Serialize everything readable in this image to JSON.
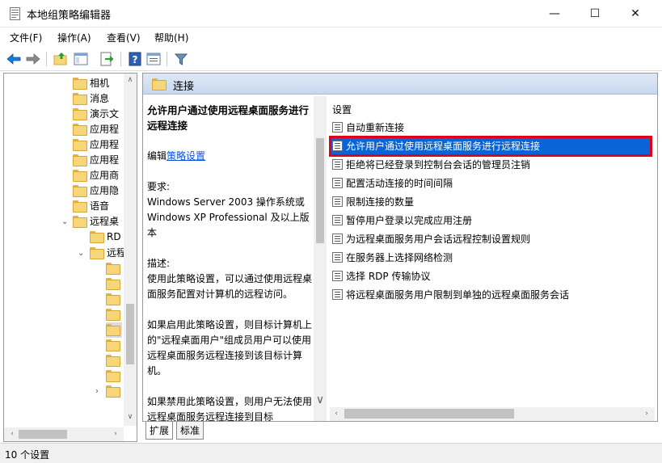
{
  "window": {
    "title": "本地组策略编辑器",
    "minimize": "—",
    "maximize": "☐",
    "close": "✕"
  },
  "menu": [
    {
      "label": "文件(F)"
    },
    {
      "label": "操作(A)"
    },
    {
      "label": "查看(V)"
    },
    {
      "label": "帮助(H)"
    }
  ],
  "toolbar": [
    "back-icon",
    "forward-icon",
    "up-folder-icon",
    "show-hide-tree-icon",
    "export-list-icon",
    "help-icon",
    "properties-icon",
    "filter-icon"
  ],
  "tree": {
    "items": [
      {
        "label": "相机"
      },
      {
        "label": "消息"
      },
      {
        "label": "演示文"
      },
      {
        "label": "应用程"
      },
      {
        "label": "应用程"
      },
      {
        "label": "应用程"
      },
      {
        "label": "应用商"
      },
      {
        "label": "应用隐"
      },
      {
        "label": "语音"
      },
      {
        "label": "远程桌"
      },
      {
        "label": "RD"
      },
      {
        "label": "远程"
      },
      {
        "label": ""
      },
      {
        "label": ""
      },
      {
        "label": ""
      },
      {
        "label": ""
      },
      {
        "label": ""
      },
      {
        "label": ""
      },
      {
        "label": ""
      },
      {
        "label": ""
      },
      {
        "label": ""
      }
    ]
  },
  "right": {
    "header": "连接",
    "description": {
      "title": "允许用户通过使用远程桌面服务进行远程连接",
      "edit_prefix": "编辑",
      "edit_link": "策略设置",
      "requirements_label": "要求:",
      "requirements": "Windows Server 2003 操作系统或 Windows XP Professional 及以上版本",
      "description_label": "描述:",
      "p1": "使用此策略设置，可以通过使用远程桌面服务配置对计算机的远程访问。",
      "p2": "如果启用此策略设置，则目标计算机上的\"远程桌面用户\"组成员用户可以使用远程桌面服务远程连接到该目标计算机。",
      "p3": "如果禁用此策略设置，则用户无法使用远程桌面服务远程连接到目标"
    },
    "settings_header": "设置",
    "settings": [
      {
        "label": "自动重新连接"
      },
      {
        "label": "允许用户通过使用远程桌面服务进行远程连接"
      },
      {
        "label": "拒绝将已经登录到控制台会话的管理员注销"
      },
      {
        "label": "配置活动连接的时间间隔"
      },
      {
        "label": "限制连接的数量"
      },
      {
        "label": "暂停用户登录以完成应用注册"
      },
      {
        "label": "为远程桌面服务用户会话远程控制设置规则"
      },
      {
        "label": "在服务器上选择网络检测"
      },
      {
        "label": "选择 RDP 传输协议"
      },
      {
        "label": "将远程桌面服务用户限制到单独的远程桌面服务会话"
      }
    ],
    "selected_index": 1
  },
  "tabs": [
    {
      "label": "扩展"
    },
    {
      "label": "标准"
    }
  ],
  "status": {
    "text": "10 个设置"
  },
  "colors": {
    "selection": "#0a64d6",
    "highlight_box": "#e0001a",
    "link": "#0b4ee0"
  }
}
